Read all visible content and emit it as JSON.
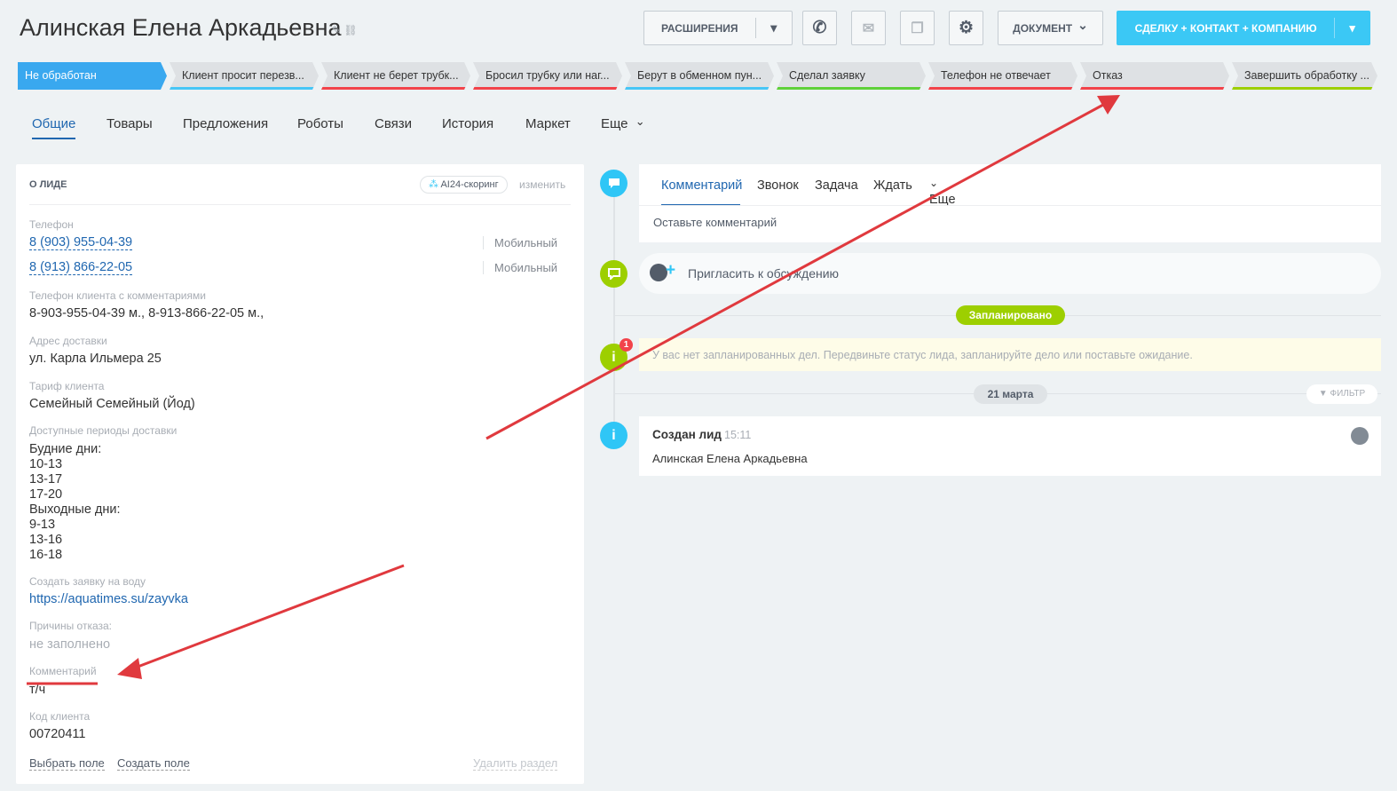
{
  "header": {
    "title": "Алинская Елена  Аркадьевна",
    "edit_icons": "✎ ⛓",
    "extensions_label": "РАСШИРЕНИЯ",
    "dropdown_arrow": "▾",
    "document_label": "ДОКУМЕНТ",
    "document_arrow": "⌄",
    "convert_label": "СДЕЛКУ + КОНТАКТ + КОМПАНИЮ"
  },
  "icons": {
    "phone": "✆",
    "mail": "✉",
    "chat": "❐",
    "gear": "⚙"
  },
  "colors": {
    "accent": "#3bc8f5",
    "active_stage": "#39a8ef",
    "link": "#2067b0",
    "green": "#9dcf00",
    "arrow_red": "#e0393e"
  },
  "stages": [
    {
      "label": "Не обработан",
      "bar": "#39a8ef",
      "active": true
    },
    {
      "label": "Клиент просит перезв...",
      "bar": "#47c6f6"
    },
    {
      "label": "Клиент не берет трубк...",
      "bar": "#f2434a"
    },
    {
      "label": "Бросил трубку или наг...",
      "bar": "#f2434a"
    },
    {
      "label": "Берут в обменном пун...",
      "bar": "#47c6f6"
    },
    {
      "label": "Сделал заявку",
      "bar": "#5fd13a"
    },
    {
      "label": "Телефон не отвечает",
      "bar": "#f2434a"
    },
    {
      "label": "Отказ",
      "bar": "#f2434a"
    },
    {
      "label": "Завершить обработку ...",
      "bar": "#9dcf00"
    }
  ],
  "tabs": [
    "Общие",
    "Товары",
    "Предложения",
    "Роботы",
    "Связи",
    "История",
    "Маркет",
    "Еще"
  ],
  "tab_more_arrow": "⌄",
  "lead": {
    "section_title": "О ЛИДЕ",
    "ai_badge": "AI24-скоринг",
    "change_label": "изменить",
    "phone_label": "Телефон",
    "phones": [
      {
        "number": "8 (903) 955-04-39",
        "type": "Мобильный"
      },
      {
        "number": "8 (913) 866-22-05",
        "type": "Мобильный"
      }
    ],
    "phone_comments_label": "Телефон клиента с комментариями",
    "phone_comments_value": "8-903-955-04-39 м., 8-913-866-22-05 м.,",
    "address_label": "Адрес доставки",
    "address_value": "ул. Карла Ильмера 25",
    "tariff_label": "Тариф клиента",
    "tariff_value": "Семейный Семейный (Йод)",
    "periods_label": "Доступные периоды доставки",
    "periods_lines": [
      "Будние дни:",
      "10-13",
      "13-17",
      "17-20",
      "Выходные дни:",
      "9-13",
      "13-16",
      "16-18"
    ],
    "order_label": "Создать заявку на воду",
    "order_link": "https://aquatimes.su/zayvka",
    "reasons_label": "Причины отказа:",
    "reasons_value": "не заполнено",
    "comment_label": "Комментарий",
    "comment_value": "т/ч",
    "client_code_label": "Код клиента",
    "client_code_value": "00720411",
    "select_field": "Выбрать поле",
    "create_field": "Создать поле",
    "delete_section": "Удалить раздел"
  },
  "timeline": {
    "composer_tabs": [
      "Комментарий",
      "Звонок",
      "Задача",
      "Ждать",
      "Еще"
    ],
    "composer_more_arrow": "⌄",
    "comment_placeholder": "Оставьте комментарий",
    "invite": "Пригласить к обсуждению",
    "planned_badge": "Запланировано",
    "info_counter": "1",
    "info_glyph": "i",
    "info_text": "У вас нет запланированных дел. Передвиньте статус лида, запланируйте дело или поставьте ожидание.",
    "date_badge": "21 марта",
    "filter": "ФИЛЬТР",
    "created_title": "Создан лид",
    "created_time": "15:11",
    "created_name": "Алинская Елена Аркадьевна"
  }
}
